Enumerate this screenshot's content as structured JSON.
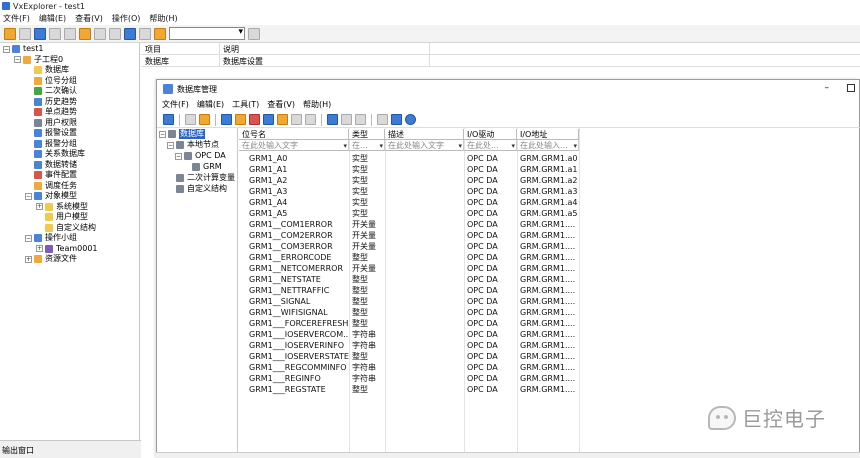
{
  "app": {
    "title": "VxExplorer - test1"
  },
  "menu": [
    "文件(F)",
    "编辑(E)",
    "查看(V)",
    "操作(O)",
    "帮助(H)"
  ],
  "tree": [
    {
      "label": "test1",
      "depth": 0,
      "exp": "⊟",
      "icon": "blue"
    },
    {
      "label": "子工程0",
      "depth": 1,
      "exp": "⊟",
      "icon": "orange"
    },
    {
      "label": "数据库",
      "depth": 2,
      "exp": "",
      "icon": "yellow"
    },
    {
      "label": "位号分组",
      "depth": 2,
      "exp": "",
      "icon": "orange"
    },
    {
      "label": "二次确认",
      "depth": 2,
      "exp": "",
      "icon": "green"
    },
    {
      "label": "历史趋势",
      "depth": 2,
      "exp": "",
      "icon": "blue"
    },
    {
      "label": "单点趋势",
      "depth": 2,
      "exp": "",
      "icon": "red"
    },
    {
      "label": "用户权限",
      "depth": 2,
      "exp": "",
      "icon": "gray"
    },
    {
      "label": "报警设置",
      "depth": 2,
      "exp": "",
      "icon": "blue"
    },
    {
      "label": "报警分组",
      "depth": 2,
      "exp": "",
      "icon": "blue"
    },
    {
      "label": "关系数据库",
      "depth": 2,
      "exp": "",
      "icon": "blue"
    },
    {
      "label": "数据转储",
      "depth": 2,
      "exp": "",
      "icon": "blue"
    },
    {
      "label": "事件配置",
      "depth": 2,
      "exp": "",
      "icon": "red"
    },
    {
      "label": "调度任务",
      "depth": 2,
      "exp": "",
      "icon": "orange"
    },
    {
      "label": "对象模型",
      "depth": 2,
      "exp": "⊟",
      "icon": "blue"
    },
    {
      "label": "系统模型",
      "depth": 3,
      "exp": "⊞",
      "icon": "yellow"
    },
    {
      "label": "用户模型",
      "depth": 3,
      "exp": "",
      "icon": "yellow"
    },
    {
      "label": "自定义结构",
      "depth": 3,
      "exp": "",
      "icon": "yellow"
    },
    {
      "label": "操作小组",
      "depth": 2,
      "exp": "⊟",
      "icon": "blue"
    },
    {
      "label": "Team0001",
      "depth": 3,
      "exp": "⊞",
      "icon": "purple"
    },
    {
      "label": "资源文件",
      "depth": 2,
      "exp": "⊞",
      "icon": "orange"
    }
  ],
  "output_window": "输出窗口",
  "right_panel": {
    "headers": [
      "项目",
      "说明"
    ],
    "row": [
      "数据库",
      "数据库设置"
    ]
  },
  "dialog": {
    "title": "数据库管理",
    "menu": [
      "文件(F)",
      "编辑(E)",
      "工具(T)",
      "查看(V)",
      "帮助(H)"
    ],
    "tree": [
      {
        "label": "数据库",
        "depth": 0,
        "exp": "⊟",
        "selected": true
      },
      {
        "label": "本地节点",
        "depth": 1,
        "exp": "⊟"
      },
      {
        "label": "OPC DA",
        "depth": 2,
        "exp": "⊟"
      },
      {
        "label": "GRM",
        "depth": 3,
        "exp": ""
      },
      {
        "label": "二次计算变量",
        "depth": 1,
        "exp": ""
      },
      {
        "label": "自定义结构",
        "depth": 1,
        "exp": ""
      }
    ],
    "columns": [
      "位号名",
      "类型",
      "描述",
      "I/O驱动",
      "I/O地址"
    ],
    "filters": [
      "在此处输入文字",
      "在...",
      "在此处输入文字",
      "在此处...",
      "在此处输入..."
    ],
    "rows": [
      [
        "GRM1_A0",
        "实型",
        "",
        "OPC DA",
        "GRM.GRM1.a0"
      ],
      [
        "GRM1_A1",
        "实型",
        "",
        "OPC DA",
        "GRM.GRM1.a1"
      ],
      [
        "GRM1_A2",
        "实型",
        "",
        "OPC DA",
        "GRM.GRM1.a2"
      ],
      [
        "GRM1_A3",
        "实型",
        "",
        "OPC DA",
        "GRM.GRM1.a3"
      ],
      [
        "GRM1_A4",
        "实型",
        "",
        "OPC DA",
        "GRM.GRM1.a4"
      ],
      [
        "GRM1_A5",
        "实型",
        "",
        "OPC DA",
        "GRM.GRM1.a5"
      ],
      [
        "GRM1__COM1ERROR",
        "开关量",
        "",
        "OPC DA",
        "GRM.GRM1...."
      ],
      [
        "GRM1__COM2ERROR",
        "开关量",
        "",
        "OPC DA",
        "GRM.GRM1...."
      ],
      [
        "GRM1__COM3ERROR",
        "开关量",
        "",
        "OPC DA",
        "GRM.GRM1...."
      ],
      [
        "GRM1__ERRORCODE",
        "整型",
        "",
        "OPC DA",
        "GRM.GRM1...."
      ],
      [
        "GRM1__NETCOMERROR",
        "开关量",
        "",
        "OPC DA",
        "GRM.GRM1...."
      ],
      [
        "GRM1__NETSTATE",
        "整型",
        "",
        "OPC DA",
        "GRM.GRM1...."
      ],
      [
        "GRM1__NETTRAFFIC",
        "整型",
        "",
        "OPC DA",
        "GRM.GRM1...."
      ],
      [
        "GRM1__SIGNAL",
        "整型",
        "",
        "OPC DA",
        "GRM.GRM1...."
      ],
      [
        "GRM1__WIFISIGNAL",
        "整型",
        "",
        "OPC DA",
        "GRM.GRM1...."
      ],
      [
        "GRM1___FORCEREFRESH",
        "整型",
        "",
        "OPC DA",
        "GRM.GRM1...."
      ],
      [
        "GRM1___IOSERVERCOM...",
        "字符串",
        "",
        "OPC DA",
        "GRM.GRM1...."
      ],
      [
        "GRM1___IOSERVERINFO",
        "字符串",
        "",
        "OPC DA",
        "GRM.GRM1...."
      ],
      [
        "GRM1___IOSERVERSTATE",
        "整型",
        "",
        "OPC DA",
        "GRM.GRM1...."
      ],
      [
        "GRM1___REGCOMMINFO",
        "字符串",
        "",
        "OPC DA",
        "GRM.GRM1...."
      ],
      [
        "GRM1___REGINFO",
        "字符串",
        "",
        "OPC DA",
        "GRM.GRM1...."
      ],
      [
        "GRM1___REGSTATE",
        "整型",
        "",
        "OPC DA",
        "GRM.GRM1...."
      ]
    ]
  },
  "watermark": "巨控电子"
}
